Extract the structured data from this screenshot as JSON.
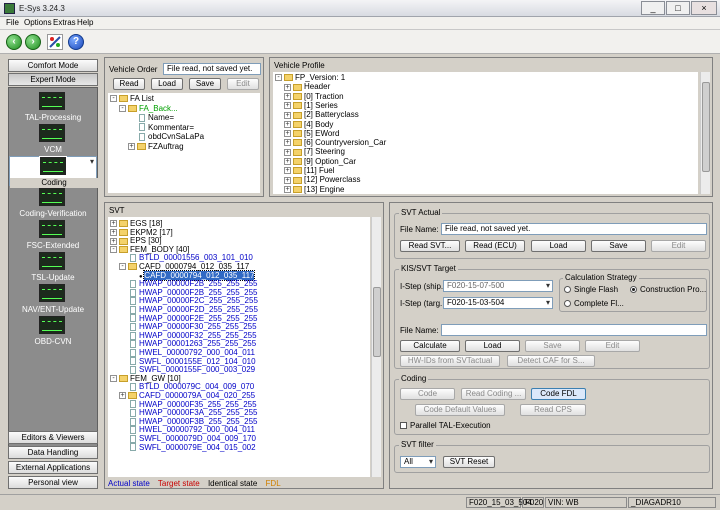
{
  "window": {
    "title": "E-Sys 3.24.3",
    "minimize": "_",
    "maximize": "□",
    "close": "×"
  },
  "menu": [
    "File",
    "Options",
    "Extras",
    "Help"
  ],
  "sidebar": {
    "top_buttons": [
      "Comfort Mode",
      "Expert Mode"
    ],
    "items": [
      "TAL-Processing",
      "VCM",
      "Coding",
      "Coding-Verification",
      "FSC-Extended",
      "TSL-Update",
      "NAV/ENT-Update",
      "OBD-CVN"
    ],
    "selected": "Coding",
    "bottom_buttons": [
      "Editors & Viewers",
      "Data Handling",
      "External Applications",
      "Personal view"
    ]
  },
  "vehicle_order": {
    "title": "Vehicle Order",
    "status": "File read, not saved yet.",
    "buttons": [
      "Read",
      "Load",
      "Save",
      "Edit"
    ],
    "tree": [
      {
        "label": "FA List",
        "level": 0,
        "icon": "folder",
        "exp": "-"
      },
      {
        "label": "FA_Back...",
        "level": 1,
        "icon": "folder",
        "exp": "-",
        "green": true
      },
      {
        "label": "Name=",
        "level": 2,
        "icon": "doc"
      },
      {
        "label": "Kommentar=",
        "level": 2,
        "icon": "doc"
      },
      {
        "label": "obdCvnSaLaPa",
        "level": 2,
        "icon": "doc"
      },
      {
        "label": "FZAuftrag",
        "level": 2,
        "icon": "folder",
        "exp": "+"
      }
    ]
  },
  "vehicle_profile": {
    "title": "Vehicle Profile",
    "tree": [
      {
        "label": "FP_Version: 1",
        "level": 0,
        "icon": "folder",
        "exp": "-"
      },
      {
        "label": "Header",
        "level": 1,
        "icon": "folder",
        "exp": "+"
      },
      {
        "label": "[0] Traction",
        "level": 1,
        "icon": "folder",
        "exp": "+"
      },
      {
        "label": "[1] Series",
        "level": 1,
        "icon": "folder",
        "exp": "+"
      },
      {
        "label": "[2] Batteryclass",
        "level": 1,
        "icon": "folder",
        "exp": "+"
      },
      {
        "label": "[4] Body",
        "level": 1,
        "icon": "folder",
        "exp": "+"
      },
      {
        "label": "[5] EWord",
        "level": 1,
        "icon": "folder",
        "exp": "+"
      },
      {
        "label": "[6] Countryversion_Car",
        "level": 1,
        "icon": "folder",
        "exp": "+"
      },
      {
        "label": "[7] Steering",
        "level": 1,
        "icon": "folder",
        "exp": "+"
      },
      {
        "label": "[9] Option_Car",
        "level": 1,
        "icon": "folder",
        "exp": "+"
      },
      {
        "label": "[11] Fuel",
        "level": 1,
        "icon": "folder",
        "exp": "+"
      },
      {
        "label": "[12] Powerclass",
        "level": 1,
        "icon": "folder",
        "exp": "+"
      },
      {
        "label": "[13] Engine",
        "level": 1,
        "icon": "folder",
        "exp": "+"
      }
    ]
  },
  "svt": {
    "title": "SVT",
    "tree": [
      {
        "label": "EGS [18]",
        "level": 0,
        "icon": "folder",
        "exp": "+"
      },
      {
        "label": "EKPM2 [17]",
        "level": 0,
        "icon": "folder",
        "exp": "+"
      },
      {
        "label": "EPS [30]",
        "level": 0,
        "icon": "folder",
        "exp": "+"
      },
      {
        "label": "FEM_BODY [40]",
        "level": 0,
        "icon": "folder",
        "exp": "-"
      },
      {
        "label": "BTLD_00001556_003_101_010",
        "level": 1,
        "icon": "doc",
        "blue": true
      },
      {
        "label": "CAFD_0000794_012_035_117",
        "level": 1,
        "icon": "folder",
        "exp": "-"
      },
      {
        "label": "CAFD_0000794_012_035_117",
        "level": 2,
        "icon": "dot",
        "selected": true
      },
      {
        "label": "HWAP_00000F2B_255_255_255",
        "level": 1,
        "icon": "doc",
        "blue": true
      },
      {
        "label": "HWAP_00000F2B_255_255_255",
        "level": 1,
        "icon": "doc",
        "blue": true
      },
      {
        "label": "HWAP_00000F2C_255_255_255",
        "level": 1,
        "icon": "doc",
        "blue": true
      },
      {
        "label": "HWAP_00000F2D_255_255_255",
        "level": 1,
        "icon": "doc",
        "blue": true
      },
      {
        "label": "HWAP_00000F2E_255_255_255",
        "level": 1,
        "icon": "doc",
        "blue": true
      },
      {
        "label": "HWAP_00000F30_255_255_255",
        "level": 1,
        "icon": "doc",
        "blue": true
      },
      {
        "label": "HWAP_00000F32_255_255_255",
        "level": 1,
        "icon": "doc",
        "blue": true
      },
      {
        "label": "HWAP_00001263_255_255_255",
        "level": 1,
        "icon": "doc",
        "blue": true
      },
      {
        "label": "HWEL_00000792_000_004_011",
        "level": 1,
        "icon": "doc",
        "blue": true
      },
      {
        "label": "SWFL_0000155E_012_104_010",
        "level": 1,
        "icon": "doc",
        "blue": true
      },
      {
        "label": "SWFL_0000155F_000_003_029",
        "level": 1,
        "icon": "doc",
        "blue": true
      },
      {
        "label": "FEM_GW [10]",
        "level": 0,
        "icon": "folder",
        "exp": "-"
      },
      {
        "label": "BTLD_0000079C_004_009_070",
        "level": 1,
        "icon": "doc",
        "blue": true
      },
      {
        "label": "CAFD_0000079A_004_020_255",
        "level": 1,
        "icon": "folder",
        "exp": "+",
        "blue": true
      },
      {
        "label": "HWAP_00000F35_255_255_255",
        "level": 1,
        "icon": "doc",
        "blue": true
      },
      {
        "label": "HWAP_00000F3A_255_255_255",
        "level": 1,
        "icon": "doc",
        "blue": true
      },
      {
        "label": "HWAP_00000F3B_255_255_255",
        "level": 1,
        "icon": "doc",
        "blue": true
      },
      {
        "label": "HWEL_00000792_000_004_011",
        "level": 1,
        "icon": "doc",
        "blue": true
      },
      {
        "label": "SWFL_0000079D_004_009_170",
        "level": 1,
        "icon": "doc",
        "blue": true
      },
      {
        "label": "SWFL_0000079E_004_015_002",
        "level": 1,
        "icon": "doc",
        "blue": true
      }
    ],
    "legend": [
      {
        "label": "Actual state",
        "color": "#0000c8"
      },
      {
        "label": "Target state",
        "color": "#c80000"
      },
      {
        "label": "Identical state",
        "color": "#000000"
      },
      {
        "label": "FDL",
        "color": "#d08000"
      }
    ]
  },
  "svt_actual": {
    "title": "SVT Actual",
    "file_label": "File Name:",
    "file_value": "File read, not saved yet.",
    "buttons": [
      "Read SVT...",
      "Read (ECU)",
      "Load",
      "Save",
      "Edit"
    ]
  },
  "kis": {
    "title": "KIS/SVT Target",
    "istep_ship_label": "I-Step (ship...",
    "istep_ship_value": "F020-15-07-500",
    "istep_target_label": "I-Step (targ...",
    "istep_target_value": "F020-15-03-504",
    "calc_title": "Calculation Strategy",
    "radios": [
      {
        "label": "Single Flash",
        "on": false
      },
      {
        "label": "Construction Pro...",
        "on": true
      },
      {
        "label": "Complete Fl...",
        "on": false
      }
    ],
    "file_label": "File Name:",
    "buttons1": [
      "Calculate",
      "Load",
      "Save",
      "Edit"
    ],
    "buttons2": [
      "HW-IDs from SVTactual",
      "Detect CAF for S..."
    ]
  },
  "coding": {
    "title": "Coding",
    "buttons1": [
      "Code",
      "Read Coding ...",
      "Code FDL"
    ],
    "buttons2": [
      "Code Default Values",
      "Read CPS"
    ],
    "parallel": "Parallel TAL-Execution"
  },
  "svt_filter": {
    "title": "SVT filter",
    "select": "All",
    "reset": "SVT Reset"
  },
  "status": [
    "F020_15_03_504",
    "F020",
    "VIN: WB",
    "_DIAGADR10"
  ]
}
